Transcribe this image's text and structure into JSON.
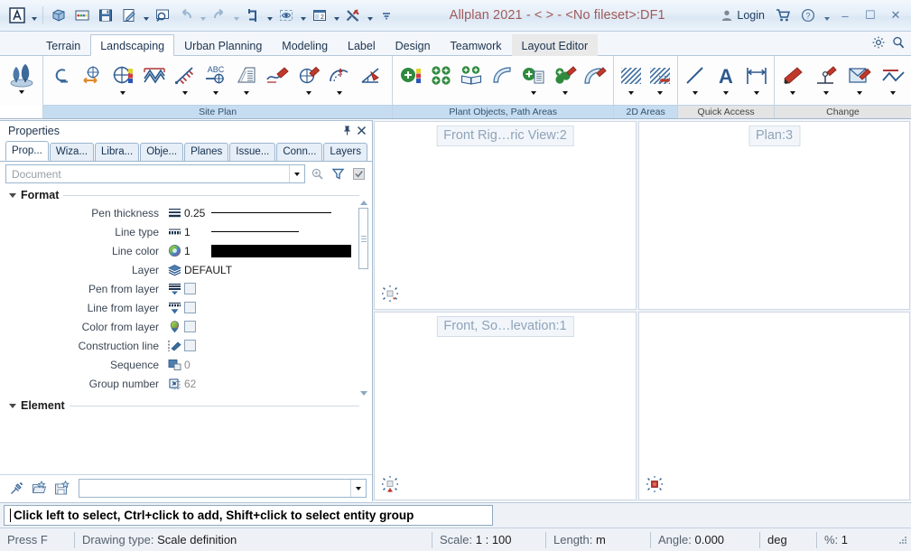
{
  "titlebar": {
    "app_icon": "allplan-logo-icon",
    "quick_access": [
      {
        "name": "new-project-icon",
        "glyph": "cube",
        "has_dropdown": false
      },
      {
        "name": "color-palette-icon",
        "glyph": "palette",
        "has_dropdown": false
      },
      {
        "name": "save-icon",
        "glyph": "floppy",
        "has_dropdown": false
      },
      {
        "name": "edit-document-icon",
        "glyph": "docpen",
        "has_dropdown": true
      },
      {
        "name": "zoom-preview-icon",
        "glyph": "magnifier-screen",
        "has_dropdown": false
      },
      {
        "name": "undo-icon",
        "glyph": "undo",
        "has_dropdown": true
      },
      {
        "name": "redo-icon",
        "glyph": "redo",
        "has_dropdown": true
      },
      {
        "name": "refresh-icon",
        "glyph": "refresh",
        "has_dropdown": true
      },
      {
        "name": "visibility-icon",
        "glyph": "eye-box",
        "has_dropdown": true
      },
      {
        "name": "window-layout-icon",
        "glyph": "layout2",
        "has_dropdown": true
      },
      {
        "name": "tools-icon",
        "glyph": "tools",
        "has_dropdown": true
      },
      {
        "name": "customize-qat-icon",
        "glyph": "more",
        "has_dropdown": false
      }
    ],
    "title": "Allplan 2021 - <       > - <No fileset>:DF1",
    "login_label": "Login",
    "cart_icon": "shopping-cart-icon",
    "help_icon": "help-circle-icon",
    "minimize": "–",
    "maximize": "☐",
    "close": "✕"
  },
  "ribbon": {
    "tabs": [
      {
        "label": "Terrain",
        "state": "normal"
      },
      {
        "label": "Landscaping",
        "state": "active"
      },
      {
        "label": "Urban Planning",
        "state": "normal"
      },
      {
        "label": "Modeling",
        "state": "normal"
      },
      {
        "label": "Label",
        "state": "normal"
      },
      {
        "label": "Design",
        "state": "normal"
      },
      {
        "label": "Teamwork",
        "state": "normal"
      },
      {
        "label": "Layout Editor",
        "state": "context"
      }
    ],
    "right_icons": [
      {
        "name": "settings-gear-icon"
      },
      {
        "name": "search-magnifier-icon"
      }
    ],
    "groups": [
      {
        "label": "",
        "label_style": "none",
        "items": [
          {
            "name": "site-plan-trees-button",
            "glyph": "trees",
            "caret": true,
            "size": "big"
          }
        ]
      },
      {
        "label": "Site Plan",
        "label_style": "blue",
        "items": [
          {
            "name": "terrain-curve-button",
            "glyph": "curve",
            "caret": false
          },
          {
            "name": "move-symbol-button",
            "glyph": "move-circle",
            "caret": false
          },
          {
            "name": "symbol-color-button",
            "glyph": "circle-colors",
            "caret": true
          },
          {
            "name": "contour-lines-button",
            "glyph": "contours",
            "caret": false
          },
          {
            "name": "section-line-button",
            "glyph": "section",
            "caret": true
          },
          {
            "name": "abc-label-button",
            "glyph": "abc-target",
            "caret": true
          },
          {
            "name": "building-site-button",
            "glyph": "building",
            "caret": true
          },
          {
            "name": "modify-line-button",
            "glyph": "pen-line",
            "caret": false
          },
          {
            "name": "modify-symbol-button",
            "glyph": "pen-circle",
            "caret": true
          },
          {
            "name": "modify-arc-button",
            "glyph": "pen-arc",
            "caret": true
          },
          {
            "name": "modify-angle-button",
            "glyph": "pen-angle",
            "caret": false
          }
        ]
      },
      {
        "label": "Plant Objects, Path Areas",
        "label_style": "blue",
        "items": [
          {
            "name": "add-plant-button",
            "glyph": "plant-plus",
            "caret": false
          },
          {
            "name": "plant-grid-button",
            "glyph": "plant-grid",
            "caret": false
          },
          {
            "name": "plant-catalog-button",
            "glyph": "plant-book",
            "caret": false
          },
          {
            "name": "path-area-button",
            "glyph": "path",
            "caret": false
          },
          {
            "name": "plant-list-button",
            "glyph": "plant-list",
            "caret": true
          },
          {
            "name": "modify-plant-button",
            "glyph": "plant-pen",
            "caret": true
          },
          {
            "name": "modify-path-button",
            "glyph": "path-pen",
            "caret": false
          }
        ]
      },
      {
        "label": "2D Areas",
        "label_style": "blue",
        "items": [
          {
            "name": "hatching-button",
            "glyph": "hatch",
            "caret": true
          },
          {
            "name": "pattern-fill-button",
            "glyph": "hatch-fill",
            "caret": true
          }
        ]
      },
      {
        "label": "Quick Access",
        "label_style": "grey",
        "items": [
          {
            "name": "line-tool-button",
            "glyph": "line",
            "caret": true
          },
          {
            "name": "text-tool-button",
            "glyph": "letter-a",
            "caret": true
          },
          {
            "name": "dimension-line-button",
            "glyph": "dimension",
            "caret": true
          }
        ]
      },
      {
        "label": "Change",
        "label_style": "grey",
        "items": [
          {
            "name": "eraser-button",
            "glyph": "eraser",
            "caret": true
          },
          {
            "name": "modify-point-button",
            "glyph": "point-edit",
            "caret": true
          },
          {
            "name": "modify-format-button",
            "glyph": "format-edit",
            "caret": true
          },
          {
            "name": "modify-polyline-button",
            "glyph": "polyline-edit",
            "caret": true
          }
        ]
      }
    ]
  },
  "properties": {
    "title": "Properties",
    "pin_icon": "pin-icon",
    "close_icon": "close-icon",
    "tabs": [
      {
        "label": "Prop...",
        "active": true
      },
      {
        "label": "Wiza...",
        "active": false
      },
      {
        "label": "Libra...",
        "active": false
      },
      {
        "label": "Obje...",
        "active": false
      },
      {
        "label": "Planes",
        "active": false
      },
      {
        "label": "Issue...",
        "active": false
      },
      {
        "label": "Conn...",
        "active": false
      },
      {
        "label": "Layers",
        "active": false
      }
    ],
    "search": {
      "placeholder": "Document",
      "value": "",
      "dropdown_icon": "chevron-down-icon",
      "zoom_icon": "zoom-icon",
      "filter_icon": "filter-funnel-icon",
      "check_icon": "checkbox-checked-icon"
    },
    "sections": [
      {
        "title": "Format",
        "expanded": true,
        "rows": [
          {
            "label": "Pen thickness",
            "icon": "pen-thickness-icon",
            "value": "0.25",
            "render": "line-thick"
          },
          {
            "label": "Line type",
            "icon": "line-type-icon",
            "value": "1",
            "render": "line-thin"
          },
          {
            "label": "Line color",
            "icon": "color-wheel-icon",
            "value": "1",
            "render": "swatch",
            "swatch_color": "#000000"
          },
          {
            "label": "Layer",
            "icon": "layers-icon",
            "value": "DEFAULT",
            "render": "text"
          },
          {
            "label": "Pen from layer",
            "icon": "pen-from-layer-icon",
            "value": "",
            "render": "checkbox",
            "checked": false
          },
          {
            "label": "Line from layer",
            "icon": "line-from-layer-icon",
            "value": "",
            "render": "checkbox",
            "checked": false
          },
          {
            "label": "Color from layer",
            "icon": "color-from-layer-icon",
            "value": "",
            "render": "checkbox",
            "checked": false
          },
          {
            "label": "Construction line",
            "icon": "construction-line-icon",
            "value": "",
            "render": "checkbox",
            "checked": false
          },
          {
            "label": "Sequence",
            "icon": "sequence-icon",
            "value": "0",
            "render": "dim-text"
          },
          {
            "label": "Group number",
            "icon": "group-number-icon",
            "value": "62",
            "render": "dim-text"
          }
        ]
      },
      {
        "title": "Element",
        "expanded": true,
        "rows": []
      }
    ],
    "footer": {
      "pipette_icon": "eyedropper-icon",
      "open_favorite_icon": "open-favorite-icon",
      "save_favorite_icon": "save-favorite-icon",
      "combo_value": "",
      "combo_dropdown_icon": "chevron-down-icon"
    }
  },
  "workspace": {
    "viewports": [
      {
        "name": "viewport-isometric",
        "label": "Front Rig…ric View:2",
        "compass": "compass-grey-icon",
        "position": "top-left"
      },
      {
        "name": "viewport-plan",
        "label": "Plan:3",
        "compass": null,
        "position": "top-right"
      },
      {
        "name": "viewport-elevation",
        "label": "Front, So…levation:1",
        "compass": "compass-red-triangle-icon",
        "position": "bottom-left"
      },
      {
        "name": "viewport-free",
        "label": "",
        "compass": "compass-red-icon",
        "position": "bottom-right"
      }
    ]
  },
  "command_bar": {
    "prompt": "Click left to select, Ctrl+click to add, Shift+click to select entity group",
    "value": ""
  },
  "statusbar": {
    "cells": [
      {
        "name": "press-f-hint",
        "key": "Press F",
        "value": ""
      },
      {
        "name": "drawing-type",
        "key": "Drawing type:",
        "value": "Scale definition"
      },
      {
        "name": "scale",
        "key": "Scale:",
        "value": "1 : 100"
      },
      {
        "name": "length-unit",
        "key": "Length:",
        "value": "m"
      },
      {
        "name": "angle",
        "key": "Angle:",
        "value": "0.000"
      },
      {
        "name": "angle-unit",
        "key": "",
        "value": "deg"
      },
      {
        "name": "percent",
        "key": "%:",
        "value": "1"
      }
    ],
    "resize_grip": "resize-grip-icon"
  },
  "colors": {
    "accent_blue": "#2d5a8e",
    "title_text": "#a05a5a",
    "group_label_bg": "#c6dcf0",
    "ribbon_bg": "#fdfdfe",
    "viewport_label_text": "#8fa3b8"
  }
}
